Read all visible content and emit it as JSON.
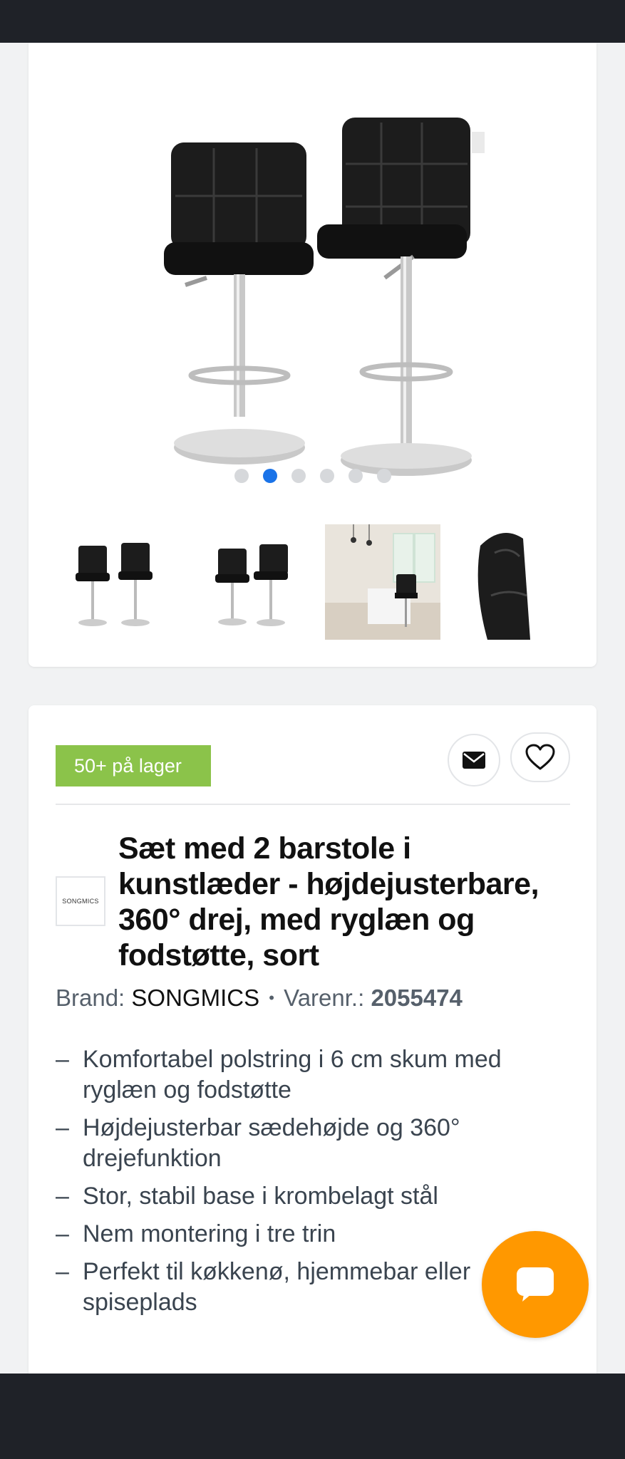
{
  "gallery": {
    "main_image_alt": "product-image-two-barstools",
    "dots_count": 6,
    "active_dot": 1,
    "thumbnails": [
      "thumbnail-barstools-front",
      "thumbnail-barstools-alt",
      "thumbnail-kitchen-scene",
      "thumbnail-seat-detail"
    ]
  },
  "product": {
    "stock_badge": "50+ på lager",
    "brand_logo_text": "SONGMICS",
    "title": "Sæt med 2 barstole i kunstlæder - højdejusterbare, 360° drej, med ryglæn og fodstøtte, sort",
    "brand_label": "Brand:",
    "brand_value": "SONGMICS",
    "separator": "•",
    "sku_label": "Varenr.:",
    "sku_value": "2055474",
    "features": [
      "Komfortabel polstring i 6 cm skum med ryglæn og fodstøtte",
      "Højdejusterbar sædehøjde og 360° drejefunktion",
      "Stor, stabil base i krombelagt stål",
      "Nem montering i tre trin",
      "Perfekt til køkkenø, hjemmebar eller spiseplads"
    ],
    "feature_bullet": "–"
  },
  "colors": {
    "accent_blue": "#1a73e8",
    "stock_green": "#8bc34a",
    "chat_orange": "#ff9800",
    "dark_bar": "#1f2228"
  },
  "icons": {
    "mail": "envelope-icon",
    "wishlist": "heart-icon",
    "chat": "chat-bubble-icon"
  }
}
